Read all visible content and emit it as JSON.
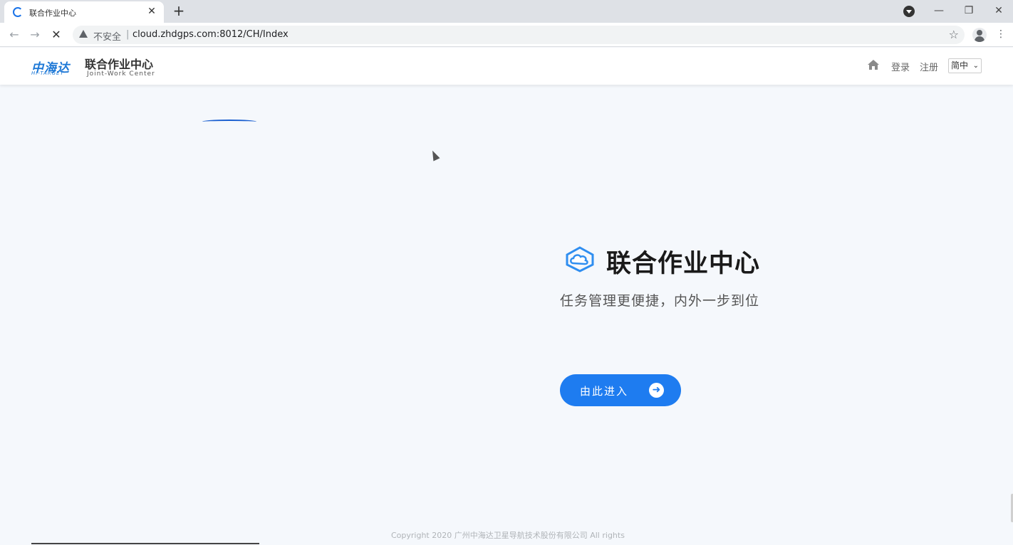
{
  "browser": {
    "tab_title": "联合作业中心",
    "close_glyph": "✕",
    "newtab_glyph": "+",
    "window_controls": {
      "minimize": "—",
      "restore": "❐",
      "close": "✕"
    },
    "nav": {
      "back": "←",
      "forward": "→",
      "stop": "✕"
    },
    "insecure_label": "不安全",
    "separator": "|",
    "url": "cloud.zhdgps.com:8012/CH/Index",
    "star_glyph": "☆",
    "menu_glyph": "⋮"
  },
  "header": {
    "brand_cn": "中海达",
    "brand_en": "HI-TARGET",
    "site_name": "联合作业中心",
    "site_subtitle": "Joint-Work Center",
    "login": "登录",
    "register": "注册",
    "language": "简中",
    "language_chevron": "⌄"
  },
  "hero": {
    "title": "联合作业中心",
    "subtitle": "任务管理更便捷，内外一步到位",
    "enter_button": "由此进入",
    "enter_arrow": "➜"
  },
  "footer": {
    "copyright": "Copyright 2020 广州中海达卫星导航技术股份有限公司 All rights"
  },
  "colors": {
    "accent": "#1e7cf0",
    "brand": "#1e78d6",
    "page_bg": "#f5f8fc"
  },
  "icons": {
    "home": "home-icon",
    "hero": "cloud-icon",
    "warning": "warning-icon",
    "star": "star-icon",
    "profile": "avatar-icon"
  }
}
